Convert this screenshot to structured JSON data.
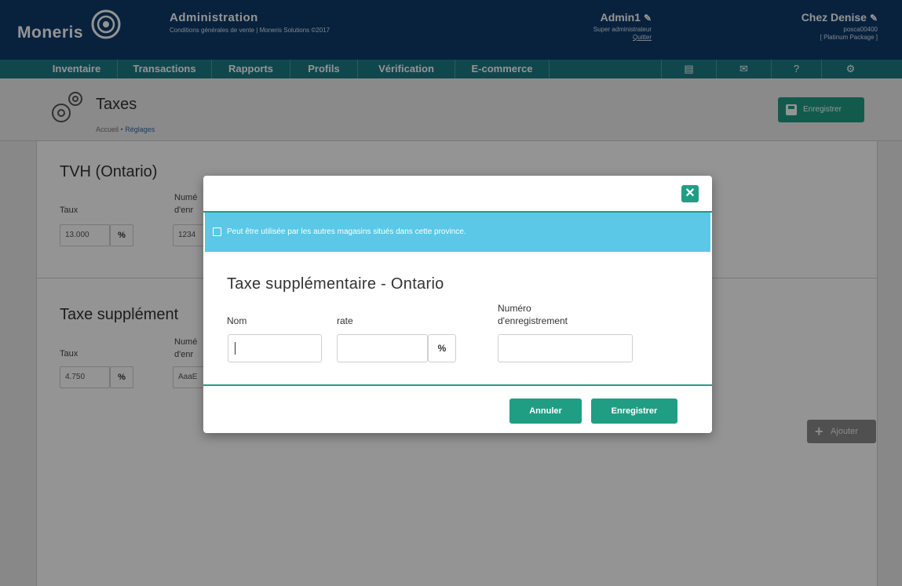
{
  "brand": {
    "logo_text": "Moneris"
  },
  "header": {
    "title": "Administration",
    "subtitle": "Conditions générales de vente | Moneris Solutions ©2017",
    "user_name": "Admin1",
    "user_role": "Super administrateur",
    "quit": "Quitter",
    "store_name": "Chez Denise",
    "store_id": "posca00400",
    "store_package": "[ Platinum Package ]"
  },
  "nav": {
    "items": [
      "Inventaire",
      "Transactions",
      "Rapports",
      "Profils",
      "Vérification",
      "E-commerce"
    ],
    "icons": [
      "register-icon",
      "mail-icon",
      "help-icon",
      "settings-icon"
    ]
  },
  "page": {
    "title": "Taxes",
    "breadcrumb_home": "Accueil",
    "breadcrumb_sep": "•",
    "breadcrumb_current": "Réglages",
    "save_label": "Enregistrer"
  },
  "cards": {
    "tvh": {
      "title": "TVH (Ontario)",
      "rate_label": "Taux",
      "rate_value": "13.000",
      "pct": "%",
      "reg_label_1": "Numé",
      "reg_label_2": "d'enr",
      "reg_value": "1234"
    },
    "extra": {
      "title": "Taxe supplément",
      "rate_label": "Taux",
      "rate_value": "4.750",
      "pct": "%",
      "reg_label_1": "Numé",
      "reg_label_2": "d'enr",
      "reg_value": "AaaE"
    },
    "add_label": "Ajouter"
  },
  "modal": {
    "info": "Peut être utilisée par les autres magasins situés dans cette province.",
    "title": "Taxe supplémentaire - Ontario",
    "name_label": "Nom",
    "name_value": "",
    "rate_label": "rate",
    "rate_value": "",
    "pct": "%",
    "reg_label_1": "Numéro",
    "reg_label_2": "d'enregistrement",
    "reg_value": "",
    "cancel": "Annuler",
    "save": "Enregistrer",
    "close": "✕"
  },
  "colors": {
    "header_bg": "#0f3c6b",
    "nav_bg": "#1c7a86",
    "accent": "#1f9e84",
    "info_bg": "#5ac8e6"
  }
}
